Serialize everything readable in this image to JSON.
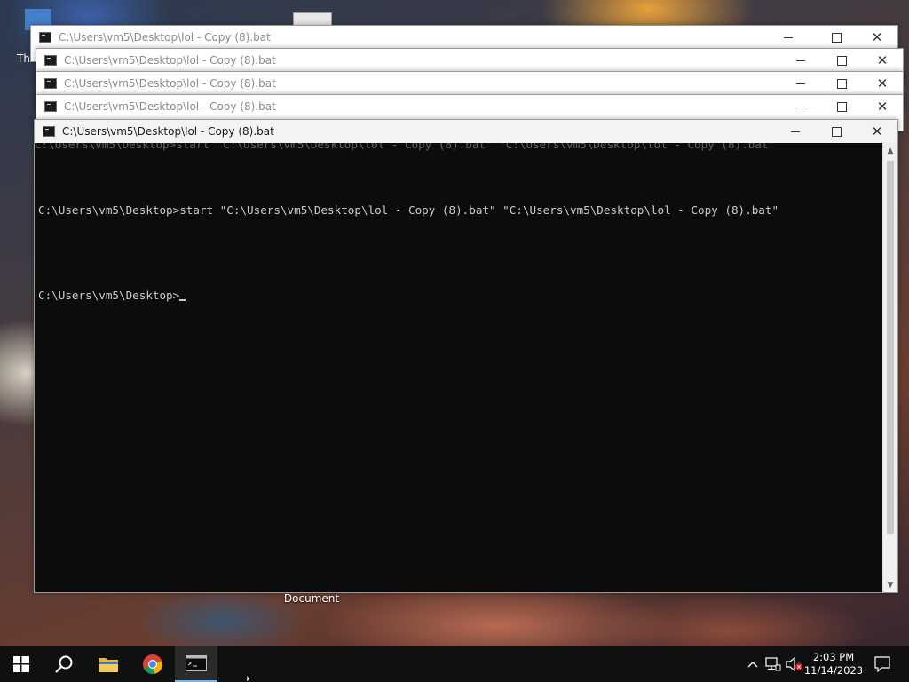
{
  "desktop": {
    "label_fragment": "Th",
    "document_label": "Document"
  },
  "windows": [
    {
      "title": "C:\\Users\\vm5\\Desktop\\lol - Copy (8).bat"
    },
    {
      "title": "C:\\Users\\vm5\\Desktop\\lol - Copy (8).bat"
    },
    {
      "title": "C:\\Users\\vm5\\Desktop\\lol - Copy (8).bat"
    },
    {
      "title": "C:\\Users\\vm5\\Desktop\\lol - Copy (8).bat"
    }
  ],
  "active_window": {
    "title": "C:\\Users\\vm5\\Desktop\\lol - Copy (8).bat",
    "ghost_line": "C:\\Users\\vm5\\Desktop>start \"C:\\Users\\vm5\\Desktop\\lol - Copy (8).bat\" \"C:\\Users\\vm5\\Desktop\\lol - Copy (8).bat\"",
    "console_lines": [
      "C:\\Users\\vm5\\Desktop>start \"C:\\Users\\vm5\\Desktop\\lol - Copy (8).bat\" \"C:\\Users\\vm5\\Desktop\\lol - Copy (8).bat\"",
      "",
      "C:\\Users\\vm5\\Desktop>"
    ],
    "prompt": "C:\\Users\\vm5\\Desktop>"
  },
  "taskbar": {
    "items": [
      "start-icon",
      "search-icon",
      "file-explorer-icon",
      "chrome-icon",
      "cmd-icon"
    ],
    "active_item": "cmd-icon",
    "clock": {
      "time": "2:03 PM",
      "date": "11/14/2023"
    },
    "tray": [
      "chevron-up-icon",
      "network-icon",
      "volume-muted-icon",
      "notification-icon"
    ]
  },
  "colors": {
    "console_bg": "#0c0c0c",
    "console_fg": "#cccccc",
    "taskbar_bg": "#101010",
    "accent": "#76b9ed"
  }
}
